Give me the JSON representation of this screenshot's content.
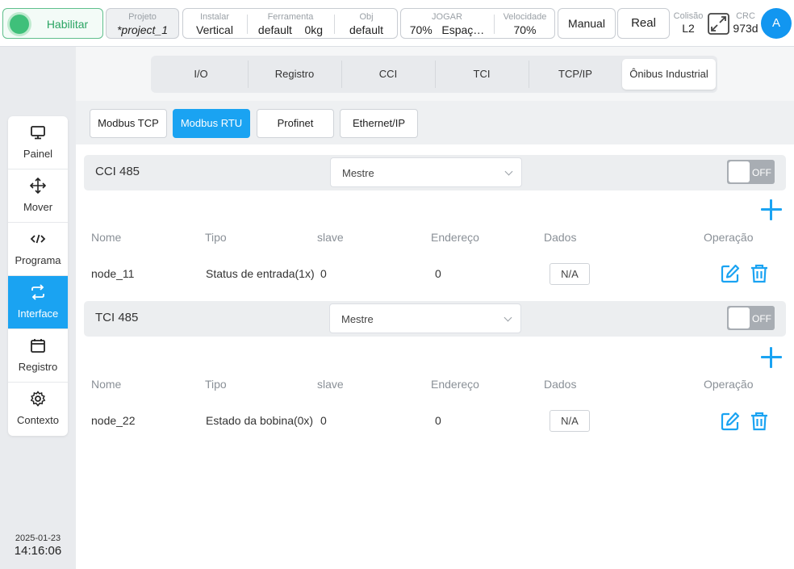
{
  "topbar": {
    "enable_label": "Habilitar",
    "project": {
      "label": "Projeto",
      "value": "*project_1"
    },
    "install": {
      "label": "Instalar",
      "value": "Vertical"
    },
    "tool": {
      "label": "Ferramenta",
      "value": "default",
      "weight": "0kg"
    },
    "obj": {
      "label": "Obj",
      "value": "default"
    },
    "jog": {
      "label": "JOGAR",
      "value": "70%",
      "mode": "Espaç…"
    },
    "speed": {
      "label": "Velocidade",
      "value": "70%"
    },
    "manual_label": "Manual",
    "real_label": "Real",
    "collision": {
      "label": "Colisão",
      "value": "L2"
    },
    "crc": {
      "label": "CRC",
      "value": "973d"
    },
    "avatar": "A"
  },
  "sidebar": {
    "items": [
      {
        "label": "Painel",
        "icon": "monitor-icon"
      },
      {
        "label": "Mover",
        "icon": "move-icon"
      },
      {
        "label": "Programa",
        "icon": "code-icon"
      },
      {
        "label": "Interface",
        "icon": "swap-icon"
      },
      {
        "label": "Registro",
        "icon": "calendar-icon"
      },
      {
        "label": "Contexto",
        "icon": "gear-icon"
      }
    ],
    "active_index": 3,
    "date": "2025-01-23",
    "time": "14:16:06"
  },
  "tabs": [
    "I/O",
    "Registro",
    "CCI",
    "TCI",
    "TCP/IP",
    "Ônibus Industrial"
  ],
  "active_tab": 5,
  "subtabs": [
    "Modbus TCP",
    "Modbus RTU",
    "Profinet",
    "Ethernet/IP"
  ],
  "active_subtab": 1,
  "columns": [
    "Nome",
    "Tipo",
    "slave",
    "Endereço",
    "Dados",
    "Operação"
  ],
  "sections": [
    {
      "title": "CCI 485",
      "mode": "Mestre",
      "toggle": "OFF",
      "row": {
        "name": "node_11",
        "type": "Status de entrada(1x)",
        "slave": "0",
        "address": "0",
        "data": "N/A"
      }
    },
    {
      "title": "TCI 485",
      "mode": "Mestre",
      "toggle": "OFF",
      "row": {
        "name": "node_22",
        "type": "Estado da bobina(0x)",
        "slave": "0",
        "address": "0",
        "data": "N/A"
      }
    }
  ],
  "colors": {
    "accent": "#1aa3f2",
    "enable": "#3fc07a"
  }
}
